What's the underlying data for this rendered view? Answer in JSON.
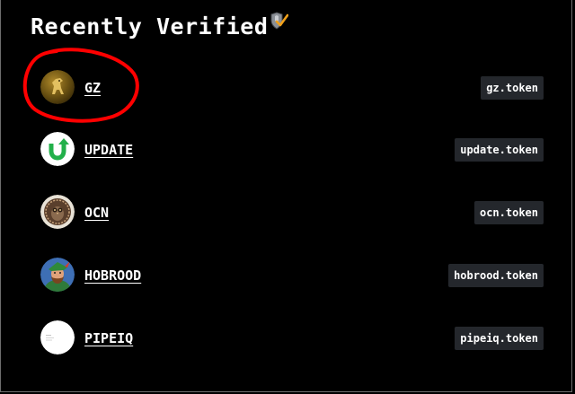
{
  "header": {
    "title": "Recently Verified",
    "icon": "verified-shield-icon"
  },
  "tokens": [
    {
      "name": "GZ",
      "account": "gz.token",
      "icon": "gold-horse-coin-icon"
    },
    {
      "name": "UPDATE",
      "account": "update.token",
      "icon": "green-u-arrow-icon"
    },
    {
      "name": "OCN",
      "account": "ocn.token",
      "icon": "owl-medallion-icon"
    },
    {
      "name": "HOBROOD",
      "account": "hobrood.token",
      "icon": "robin-hood-portrait-icon"
    },
    {
      "name": "PIPEIQ",
      "account": "pipeiq.token",
      "icon": "white-document-icon"
    }
  ],
  "annotation": {
    "type": "red-freehand-circle",
    "color": "#ff0000",
    "target": "GZ"
  },
  "colors": {
    "background": "#000000",
    "badge_background": "#24272c",
    "text": "#ffffff",
    "annotation": "#ff0000"
  }
}
